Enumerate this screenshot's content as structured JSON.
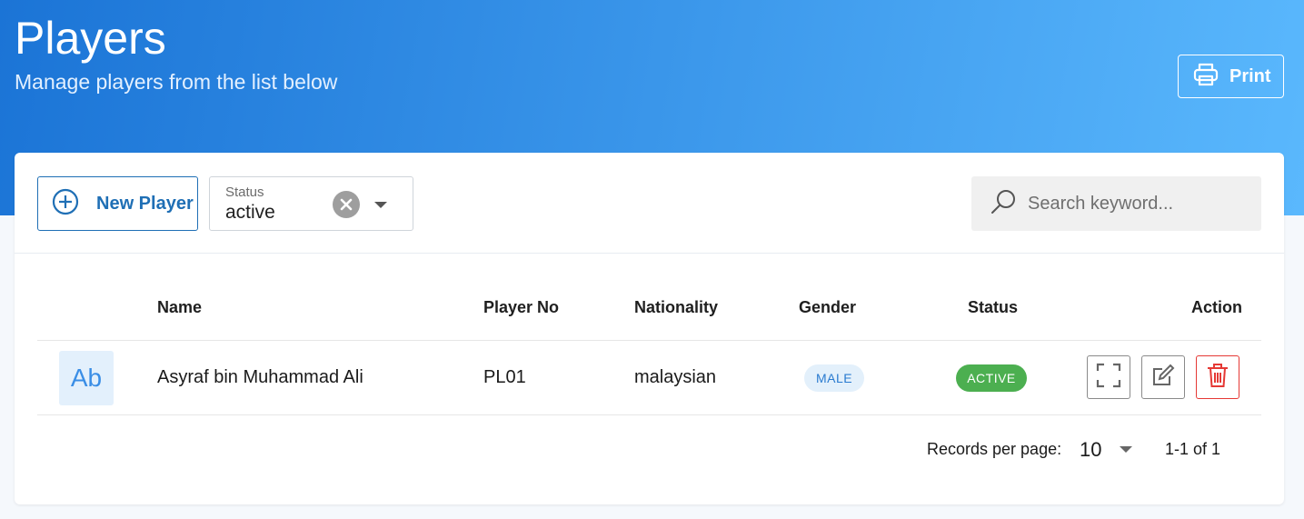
{
  "header": {
    "title": "Players",
    "subtitle": "Manage players from the list below",
    "print_label": "Print"
  },
  "toolbar": {
    "new_label": "New Player",
    "status_filter": {
      "caption": "Status",
      "value": "active"
    },
    "search_placeholder": "Search keyword..."
  },
  "table": {
    "columns": [
      "Name",
      "Player No",
      "Nationality",
      "Gender",
      "Status",
      "Action"
    ],
    "rows": [
      {
        "avatar": "Ab",
        "name": "Asyraf bin Muhammad Ali",
        "player_no": "PL01",
        "nationality": "malaysian",
        "gender": "MALE",
        "status": "ACTIVE"
      }
    ]
  },
  "pagination": {
    "records_label": "Records per page:",
    "per_page": "10",
    "range": "1-1 of 1"
  },
  "colors": {
    "primary": "#1f6fb5",
    "active": "#4caf50",
    "delete": "#e53935"
  }
}
